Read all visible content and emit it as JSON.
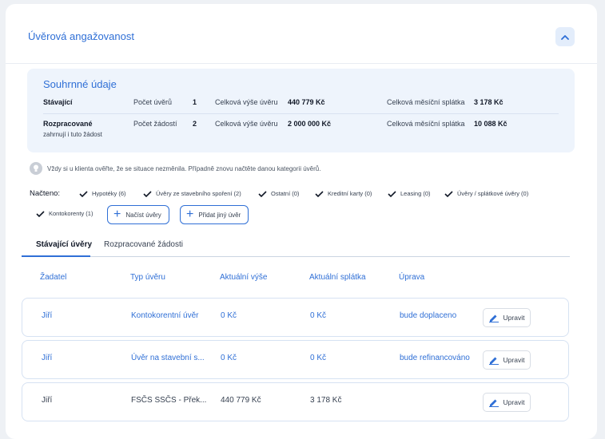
{
  "header": {
    "title": "Úvěrová angažovanost",
    "collapse_icon": "chevron-up-icon"
  },
  "summary": {
    "title": "Souhrnné údaje",
    "rows": [
      {
        "label": "Stávající",
        "sublabel": "",
        "count_label": "Počet úvěrů",
        "count": "1",
        "total_label": "Celková výše úvěru",
        "total": "440 779 Kč",
        "monthly_label": "Celková měsíční splátka",
        "monthly": "3 178 Kč"
      },
      {
        "label": "Rozpracované",
        "sublabel": "zahrnují i tuto žádost",
        "count_label": "Počet žádostí",
        "count": "2",
        "total_label": "Celková výše úvěru",
        "total": "2 000 000 Kč",
        "monthly_label": "Celková měsíční splátka",
        "monthly": "10 088 Kč"
      }
    ]
  },
  "info": {
    "text": "Vždy si u klienta ověřte, že se situace nezměnila. Případně znovu načtěte danou kategorii úvěrů.",
    "icon": "lightbulb-icon"
  },
  "loaded": {
    "label": "Načteno:",
    "items": [
      "Hypotéky (6)",
      "Úvěry ze stavebního spoření (2)",
      "Ostatní (0)",
      "Kreditní karty (0)",
      "Leasing (0)",
      "Úvěry / splátkové úvěry (0)",
      "Kontokorenty (1)"
    ],
    "load_button": "Načíst úvěry",
    "add_button": "Přidat jiný úvěr"
  },
  "tabs": [
    {
      "label": "Stávající úvěry",
      "active": true
    },
    {
      "label": "Rozpracované žádosti",
      "active": false
    }
  ],
  "table": {
    "headers": [
      "Žadatel",
      "Typ úvěru",
      "Aktuální výše",
      "Aktuální splátka",
      "Úprava"
    ],
    "edit_label": "Upravit",
    "rows": [
      {
        "applicant": "Jiří",
        "type": "Kontokorentní úvěr",
        "amount": "0 Kč",
        "payment": "0 Kč",
        "action": "bude doplaceno"
      },
      {
        "applicant": "Jiří",
        "type": "Úvěr na stavební s...",
        "amount": "0 Kč",
        "payment": "0 Kč",
        "action": "bude refinancováno"
      },
      {
        "applicant": "Jiří",
        "type": "FSČS SSČS - Přek...",
        "amount": "440 779 Kč",
        "payment": "3 178 Kč",
        "action": ""
      }
    ]
  },
  "colors": {
    "accent": "#2f6fd6",
    "summary_bg": "#eef4fc",
    "page_bg": "#eef1f5"
  }
}
